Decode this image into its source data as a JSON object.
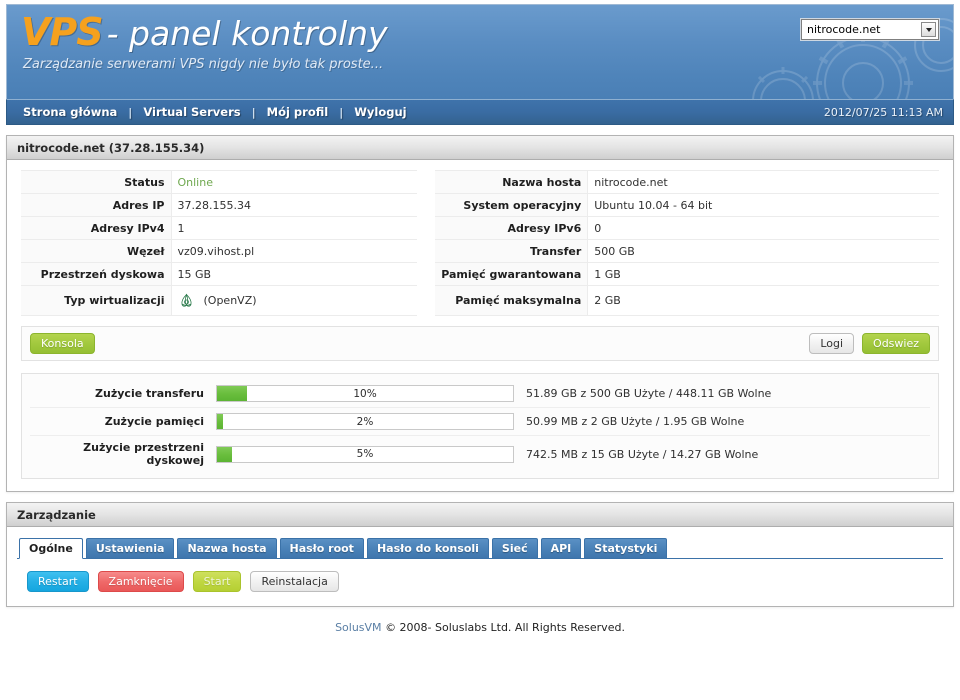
{
  "header": {
    "logo_primary": "VPS",
    "logo_secondary": "- panel kontrolny",
    "tagline": "Zarządzanie serwerami VPS nigdy nie było tak proste...",
    "server_select_value": "nitrocode.net",
    "select_arrow_icon": "chevron-down-icon"
  },
  "nav": {
    "items": [
      {
        "label": "Strona główna"
      },
      {
        "label": "Virtual Servers"
      },
      {
        "label": "Mój profil"
      },
      {
        "label": "Wyloguj"
      }
    ],
    "separator": "|",
    "datetime": "2012/07/25 11:13 AM"
  },
  "server_panel": {
    "title": "nitrocode.net (37.28.155.34)",
    "info_rows": [
      {
        "label_left": "Status",
        "value_left": "Online",
        "left_status": true,
        "label_right": "Nazwa hosta",
        "value_right": "nitrocode.net"
      },
      {
        "label_left": "Adres IP",
        "value_left": "37.28.155.34",
        "label_right": "System operacyjny",
        "value_right": "Ubuntu 10.04 - 64 bit"
      },
      {
        "label_left": "Adresy IPv4",
        "value_left": "1",
        "label_right": "Adresy IPv6",
        "value_right": "0"
      },
      {
        "label_left": "Węzeł",
        "value_left": "vz09.vihost.pl",
        "label_right": "Transfer",
        "value_right": "500 GB"
      },
      {
        "label_left": "Przestrzeń dyskowa",
        "value_left": "15 GB",
        "label_right": "Pamięć gwarantowana",
        "value_right": "1 GB"
      },
      {
        "label_left": "Typ wirtualizacji",
        "value_left": "(OpenVZ)",
        "left_icon": "openvz-logo-icon",
        "label_right": "Pamięć maksymalna",
        "value_right": "2 GB"
      }
    ],
    "buttons": {
      "console": "Konsola",
      "logs": "Logi",
      "refresh": "Odswiez"
    },
    "usage": [
      {
        "label": "Zużycie transferu",
        "percent": 10,
        "percent_text": "10%",
        "detail": "51.89 GB z 500 GB Użyte / 448.11 GB Wolne"
      },
      {
        "label": "Zużycie pamięci",
        "percent": 2,
        "percent_text": "2%",
        "detail": "50.99 MB z 2 GB Użyte / 1.95 GB Wolne"
      },
      {
        "label": "Zużycie przestrzeni dyskowej",
        "percent": 5,
        "percent_text": "5%",
        "detail": "742.5 MB z 15 GB Użyte / 14.27 GB Wolne"
      }
    ]
  },
  "management_panel": {
    "title": "Zarządzanie",
    "tabs": [
      {
        "label": "Ogólne",
        "active": true
      },
      {
        "label": "Ustawienia",
        "active": false
      },
      {
        "label": "Nazwa hosta",
        "active": false
      },
      {
        "label": "Hasło root",
        "active": false
      },
      {
        "label": "Hasło do konsoli",
        "active": false
      },
      {
        "label": "Sieć",
        "active": false
      },
      {
        "label": "API",
        "active": false
      },
      {
        "label": "Statystyki",
        "active": false
      }
    ],
    "actions": [
      {
        "label": "Restart",
        "style": "blue"
      },
      {
        "label": "Zamknięcie",
        "style": "red"
      },
      {
        "label": "Start",
        "style": "olive"
      },
      {
        "label": "Reinstalacja",
        "style": "grey"
      }
    ]
  },
  "footer": {
    "brand": "SolusVM",
    "text": "© 2008- Soluslabs Ltd. All Rights Reserved."
  },
  "colors": {
    "header_blue": "#5a8dc2",
    "nav_blue": "#3a6ca3",
    "accent_orange": "#f5a11e",
    "green_fill": "#68bd3c",
    "status_green": "#6fa84f",
    "tab_blue": "#4a82b8"
  }
}
